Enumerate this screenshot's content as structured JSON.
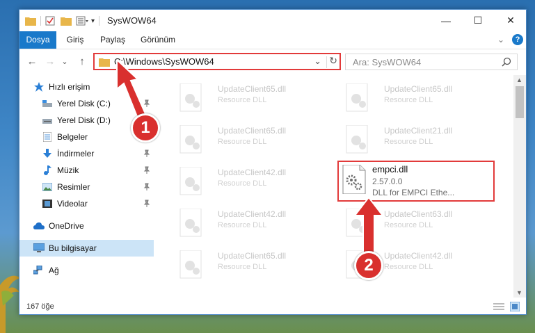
{
  "window": {
    "title": "SysWOW64",
    "controls": {
      "minimize": "—",
      "maximize": "☐",
      "close": "✕"
    }
  },
  "ribbon": {
    "tabs": [
      "Dosya",
      "Giriş",
      "Paylaş",
      "Görünüm"
    ],
    "expand_glyph": "⌄",
    "help": "?"
  },
  "nav": {
    "back": "←",
    "forward": "→",
    "recent": "⌄",
    "up": "↑",
    "address": "C:\\Windows\\SysWOW64",
    "address_dropdown": "⌄",
    "refresh": "↻",
    "search_placeholder": "Ara: SysWOW64"
  },
  "sidebar": {
    "items": [
      {
        "label": "Hızlı erişim",
        "icon": "star-icon",
        "pinned": false
      },
      {
        "label": "Yerel Disk (C:)",
        "icon": "drive-icon",
        "pinned": true
      },
      {
        "label": "Yerel Disk (D:)",
        "icon": "drive-icon",
        "pinned": true
      },
      {
        "label": "Belgeler",
        "icon": "document-icon",
        "pinned": true
      },
      {
        "label": "İndirmeler",
        "icon": "download-icon",
        "pinned": true
      },
      {
        "label": "Müzik",
        "icon": "music-icon",
        "pinned": true
      },
      {
        "label": "Resimler",
        "icon": "picture-icon",
        "pinned": true
      },
      {
        "label": "Videolar",
        "icon": "video-icon",
        "pinned": true
      },
      {
        "label": "OneDrive",
        "icon": "cloud-icon",
        "pinned": false
      },
      {
        "label": "Bu bilgisayar",
        "icon": "computer-icon",
        "pinned": false,
        "selected": true
      },
      {
        "label": "Ağ",
        "icon": "network-icon",
        "pinned": false
      }
    ]
  },
  "files": [
    {
      "name": "UpdateClient65.dll",
      "desc": "Resource DLL"
    },
    {
      "name": "UpdateClient65.dll",
      "desc": "Resource DLL"
    },
    {
      "name": "UpdateClient65.dll",
      "desc": "Resource DLL"
    },
    {
      "name": "UpdateClient21.dll",
      "desc": "Resource DLL"
    },
    {
      "name": "UpdateClient42.dll",
      "desc": "Resource DLL"
    },
    {
      "name": "UpdateClient42.dll",
      "desc": "Resource DLL"
    },
    {
      "name": "UpdateClient63.dll",
      "desc": "Resource DLL"
    },
    {
      "name": "UpdateClient65.dll",
      "desc": "Resource DLL"
    },
    {
      "name": "UpdateClient42.dll",
      "desc": "Resource DLL"
    }
  ],
  "highlighted_file": {
    "name": "empci.dll",
    "version": "2.57.0.0",
    "description": "DLL for EMPCI  Ethe..."
  },
  "status": {
    "count": "167 öğe"
  },
  "annotations": {
    "step1": "1",
    "step2": "2"
  },
  "colors": {
    "accent": "#1979ca",
    "highlight_red": "#e23a3a",
    "selected_bg": "#cce4f7"
  }
}
